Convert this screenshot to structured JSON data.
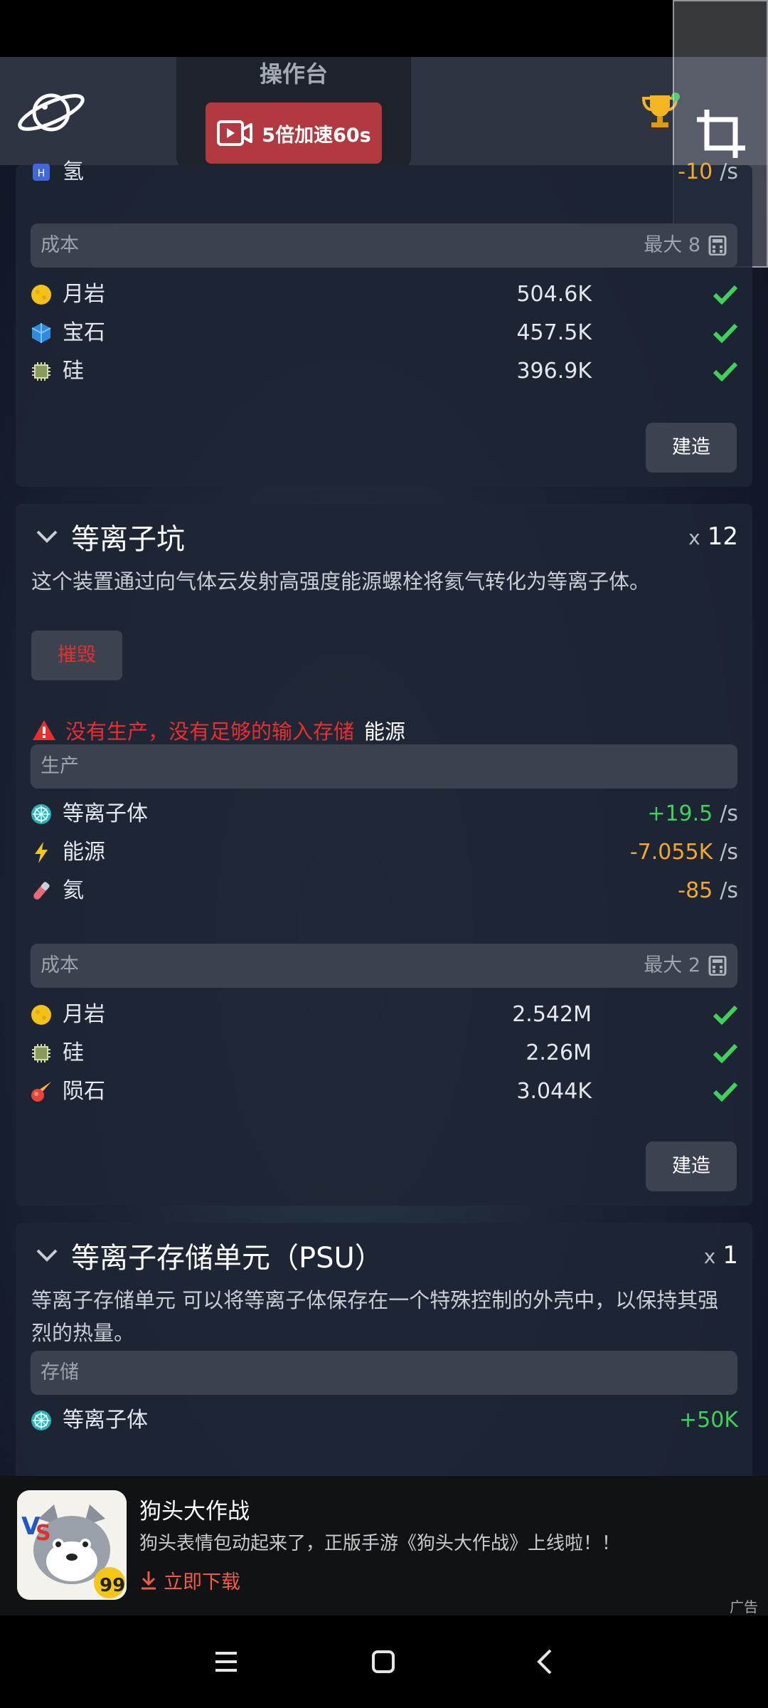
{
  "header": {
    "console_title": "操作台",
    "speed_button_label": "5倍加速60s"
  },
  "prev_card": {
    "partial_resource": {
      "name": "氢",
      "value": "-10",
      "unit": "/s"
    },
    "cost_label": "成本",
    "cost_max": "最大  8",
    "costs": [
      {
        "name": "月岩",
        "amount": "504.6K",
        "icon": "moonrock-icon"
      },
      {
        "name": "宝石",
        "amount": "457.5K",
        "icon": "gem-icon"
      },
      {
        "name": "硅",
        "amount": "396.9K",
        "icon": "silicon-icon"
      }
    ],
    "build_label": "建造"
  },
  "plasma_pit": {
    "title": "等离子坑",
    "count_prefix": "x",
    "count": "12",
    "description": "这个装置通过向气体云发射高强度能源螺栓将氦气转化为等离子体。",
    "destroy_label": "摧毁",
    "warning_text": "没有生产，没有足够的输入存储",
    "warning_resource": "能源",
    "production_label": "生产",
    "production": [
      {
        "name": "等离子体",
        "value": "+19.5",
        "unit": "/s",
        "color": "#3fd25a",
        "icon": "plasma-icon"
      },
      {
        "name": "能源",
        "value": "-7.055K",
        "unit": "/s",
        "color": "#f2a92a",
        "icon": "energy-icon"
      },
      {
        "name": "氦",
        "value": "-85",
        "unit": "/s",
        "color": "#f2a92a",
        "icon": "helium-icon"
      }
    ],
    "cost_label": "成本",
    "cost_max": "最大  2",
    "costs": [
      {
        "name": "月岩",
        "amount": "2.542M",
        "icon": "moonrock-icon"
      },
      {
        "name": "硅",
        "amount": "2.26M",
        "icon": "silicon-icon"
      },
      {
        "name": "陨石",
        "amount": "3.044K",
        "icon": "meteorite-icon"
      }
    ],
    "build_label": "建造"
  },
  "psu": {
    "title": "等离子存储单元（PSU）",
    "count_prefix": "x",
    "count": "1",
    "description": "等离子存储单元 可以将等离子体保存在一个特殊控制的外壳中，以保持其强烈的热量。",
    "storage_label": "存储",
    "storage": [
      {
        "name": "等离子体",
        "value": "+50K",
        "color": "#3fd25a",
        "icon": "plasma-icon"
      }
    ]
  },
  "ad": {
    "title": "狗头大作战",
    "description": "狗头表情包动起来了，正版手游《狗头大作战》上线啦！！",
    "download_label": "立即下载",
    "tag": "广告"
  },
  "colors": {
    "accent_red": "#b2393f",
    "positive": "#3fd25a",
    "negative": "#f2a92a",
    "warning": "#ec2d2d"
  }
}
